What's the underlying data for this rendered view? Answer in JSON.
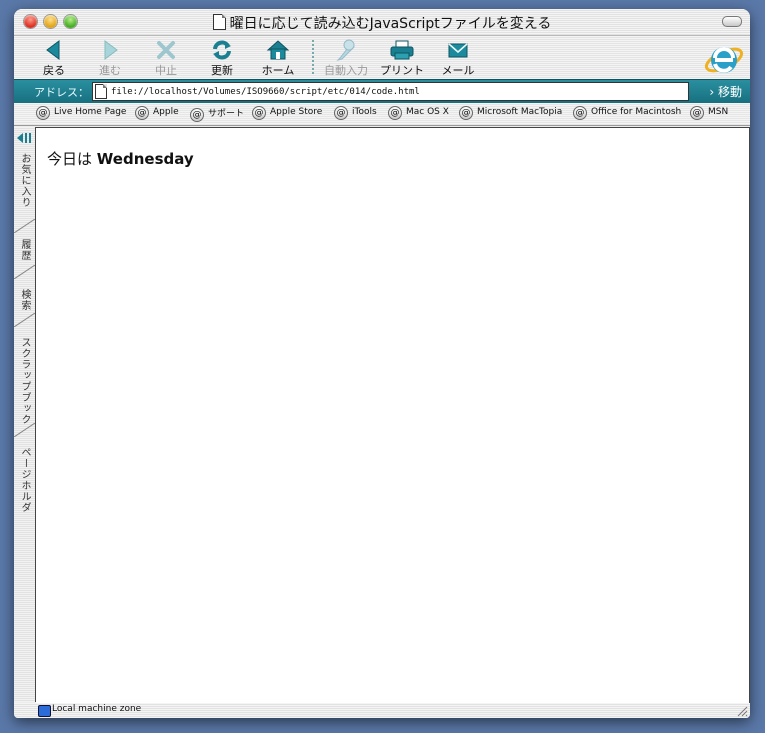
{
  "window": {
    "title": "曜日に応じて読み込むJavaScriptファイルを変える"
  },
  "toolbar": {
    "back": "戻る",
    "forward": "進む",
    "stop": "中止",
    "refresh": "更新",
    "home": "ホーム",
    "autofill": "自動入力",
    "print": "プリント",
    "mail": "メール"
  },
  "address": {
    "label": "アドレス：",
    "url": "file://localhost/Volumes/ISO9660/script/etc/014/code.html",
    "go": "移動"
  },
  "favorites": [
    "Live Home Page",
    "Apple",
    "サポート",
    "Apple Store",
    "iTools",
    "Mac OS X",
    "Microsoft MacTopia",
    "Office for Macintosh",
    "MSN"
  ],
  "sidebar": {
    "tabs": [
      "お気に入り",
      "履歴",
      "検索",
      "スクラップブック",
      "ページホルダ"
    ]
  },
  "content": {
    "prefix": "今日は",
    "day": "Wednesday"
  },
  "status": {
    "zone": "Local machine zone"
  },
  "colors": {
    "accent": "#1f7f8f",
    "icon_teal": "#1a8a9c"
  }
}
